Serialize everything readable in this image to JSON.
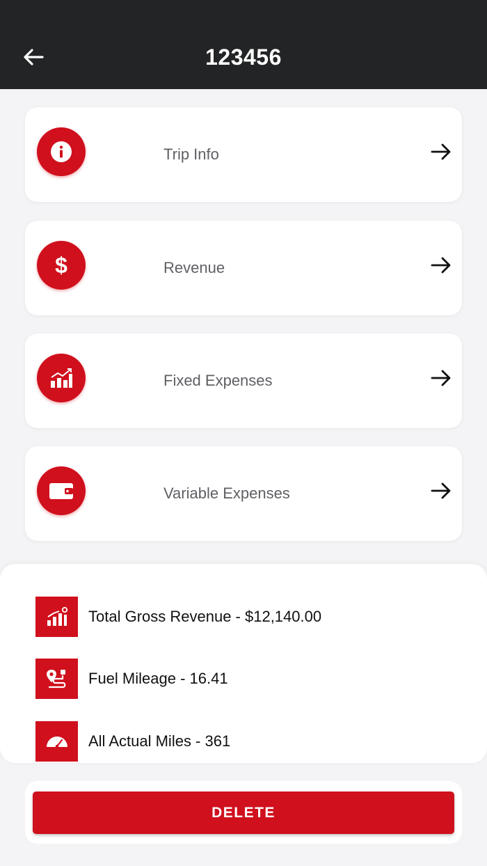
{
  "header": {
    "title": "123456",
    "back_icon": "arrow-left-icon"
  },
  "menu": {
    "items": [
      {
        "label": "Trip Info",
        "icon": "info-icon"
      },
      {
        "label": "Revenue",
        "icon": "dollar-icon"
      },
      {
        "label": "Fixed Expenses",
        "icon": "bar-chart-icon"
      },
      {
        "label": "Variable Expenses",
        "icon": "wallet-icon"
      }
    ],
    "arrow_icon": "arrow-right-icon"
  },
  "summary": {
    "rows": [
      {
        "text": "Total Gross Revenue - $12,140.00",
        "icon": "growth-chart-icon"
      },
      {
        "text": "Fuel Mileage - 16.41",
        "icon": "route-icon"
      },
      {
        "text": "All Actual Miles - 361",
        "icon": "speedometer-icon"
      }
    ]
  },
  "actions": {
    "delete_label": "DELETE"
  },
  "colors": {
    "header_bg": "#232426",
    "accent": "#d0101d",
    "background": "#f4f4f6",
    "label_text": "#5e5f63"
  }
}
